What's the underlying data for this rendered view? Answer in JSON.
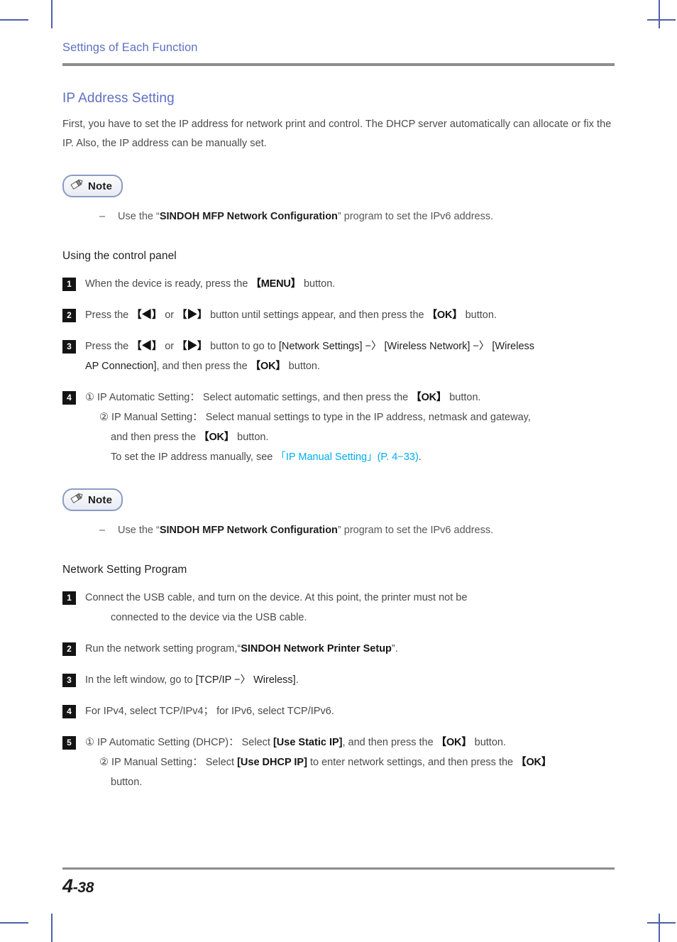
{
  "header": {
    "title": "Settings of Each Function"
  },
  "section": {
    "title": "IP Address Setting",
    "intro": "First, you have to set the IP address for network print and control. The DHCP server automatically can allocate or fix the IP. Also, the IP address can be manually set."
  },
  "note_1": {
    "badge_label": "Note",
    "icon": "pencil-icon",
    "dash": "–",
    "text_before": "Use the “",
    "emphasis": "SINDOH MFP Network Configuration",
    "text_after": "” program to set the IPv6 address."
  },
  "note_2": {
    "badge_label": "Note",
    "icon": "pencil-icon",
    "dash": "–",
    "text_before": "Use the “",
    "emphasis": "SINDOH MFP Network Configuration",
    "text_after": "” program to set the IPv6 address."
  },
  "control_panel": {
    "heading": "Using the control panel",
    "steps": [
      {
        "number": "1",
        "lines": [
          {
            "parts": [
              {
                "t": "When the device is ready, press the ",
                "s": "plain"
              },
              {
                "t": "【MENU】",
                "s": "key"
              },
              {
                "t": " button.",
                "s": "plain"
              }
            ]
          }
        ]
      },
      {
        "number": "2",
        "lines": [
          {
            "parts": [
              {
                "t": "Press the ",
                "s": "plain"
              },
              {
                "t": "【◀】",
                "s": "key"
              },
              {
                "t": " or ",
                "s": "plain"
              },
              {
                "t": "【▶】",
                "s": "key"
              },
              {
                "t": " button until settings appear, and then press the ",
                "s": "plain"
              },
              {
                "t": "【OK】",
                "s": "key"
              },
              {
                "t": " button.",
                "s": "plain"
              }
            ]
          }
        ]
      },
      {
        "number": "3",
        "lines": [
          {
            "parts": [
              {
                "t": "Press the ",
                "s": "plain"
              },
              {
                "t": "【◀】",
                "s": "key"
              },
              {
                "t": " or ",
                "s": "plain"
              },
              {
                "t": "【▶】",
                "s": "key"
              },
              {
                "t": " button to go to ",
                "s": "plain"
              },
              {
                "t": "[Network Settings]",
                "s": "menu"
              },
              {
                "t": " −〉 ",
                "s": "menu"
              },
              {
                "t": "[Wireless Network]",
                "s": "menu"
              },
              {
                "t": " −〉 ",
                "s": "menu"
              },
              {
                "t": "[Wireless",
                "s": "menu"
              }
            ]
          },
          {
            "parts": [
              {
                "t": "AP Connection]",
                "s": "menu"
              },
              {
                "t": ", and then press the ",
                "s": "plain"
              },
              {
                "t": "【OK】",
                "s": "key"
              },
              {
                "t": " button.",
                "s": "plain"
              }
            ]
          }
        ]
      },
      {
        "number": "4",
        "lines": [
          {
            "parts": [
              {
                "t": "① IP Automatic Setting： Select automatic settings, and then press the ",
                "s": "plain"
              },
              {
                "t": "【OK】",
                "s": "key"
              },
              {
                "t": " button.",
                "s": "plain"
              }
            ]
          },
          {
            "indent": 1,
            "parts": [
              {
                "t": "② IP Manual Setting： Select manual settings to type in the IP address, netmask and gateway,",
                "s": "plain"
              }
            ]
          },
          {
            "indent": 2,
            "parts": [
              {
                "t": "and then press the ",
                "s": "plain"
              },
              {
                "t": "【OK】",
                "s": "key"
              },
              {
                "t": " button.",
                "s": "plain"
              }
            ]
          },
          {
            "indent": 2,
            "parts": [
              {
                "t": "To set the IP address manually, see  ",
                "s": "plain"
              },
              {
                "t": "「IP Manual Setting」(P. 4−33)",
                "s": "link"
              },
              {
                "t": ".",
                "s": "plain"
              }
            ]
          }
        ]
      }
    ]
  },
  "network_program": {
    "heading": "Network Setting Program",
    "steps": [
      {
        "number": "1",
        "lines": [
          {
            "parts": [
              {
                "t": "Connect the USB cable, and turn on the device. At this point, the printer must not be",
                "s": "plain"
              }
            ]
          },
          {
            "indent": 2,
            "parts": [
              {
                "t": "connected to the device via the USB cable.",
                "s": "plain"
              }
            ]
          }
        ]
      },
      {
        "number": "2",
        "lines": [
          {
            "parts": [
              {
                "t": "Run the network setting program,“",
                "s": "plain"
              },
              {
                "t": "SINDOH Network Printer Setup",
                "s": "bold"
              },
              {
                "t": "”.",
                "s": "plain"
              }
            ]
          }
        ]
      },
      {
        "number": "3",
        "lines": [
          {
            "parts": [
              {
                "t": "In the left window, go to ",
                "s": "plain"
              },
              {
                "t": "[TCP/IP −〉 Wireless]",
                "s": "menu"
              },
              {
                "t": ".",
                "s": "plain"
              }
            ]
          }
        ]
      },
      {
        "number": "4",
        "lines": [
          {
            "parts": [
              {
                "t": "For IPv4, select TCP/IPv4； for IPv6, select TCP/IPv6.",
                "s": "plain"
              }
            ]
          }
        ]
      },
      {
        "number": "5",
        "lines": [
          {
            "parts": [
              {
                "t": "① IP Automatic Setting (DHCP)： Select ",
                "s": "plain"
              },
              {
                "t": "[Use Static IP]",
                "s": "bold"
              },
              {
                "t": ", and then press the ",
                "s": "plain"
              },
              {
                "t": "【OK】",
                "s": "key"
              },
              {
                "t": " button.",
                "s": "plain"
              }
            ]
          },
          {
            "indent": 1,
            "parts": [
              {
                "t": "② IP Manual Setting： Select ",
                "s": "plain"
              },
              {
                "t": "[Use DHCP IP]",
                "s": "bold"
              },
              {
                "t": " to enter network settings, and then press the ",
                "s": "plain"
              },
              {
                "t": "【OK】",
                "s": "key"
              }
            ]
          },
          {
            "indent": 2,
            "parts": [
              {
                "t": "button.",
                "s": "plain"
              }
            ]
          }
        ]
      }
    ]
  },
  "footer": {
    "page_major": "4",
    "page_minor": "-38"
  },
  "colors": {
    "heading_blue": "#5d70c4",
    "link_cyan": "#00aeef",
    "rule_gray": "#8d8d8d",
    "crop_mark": "#4e60a8",
    "step_box": "#141414"
  }
}
